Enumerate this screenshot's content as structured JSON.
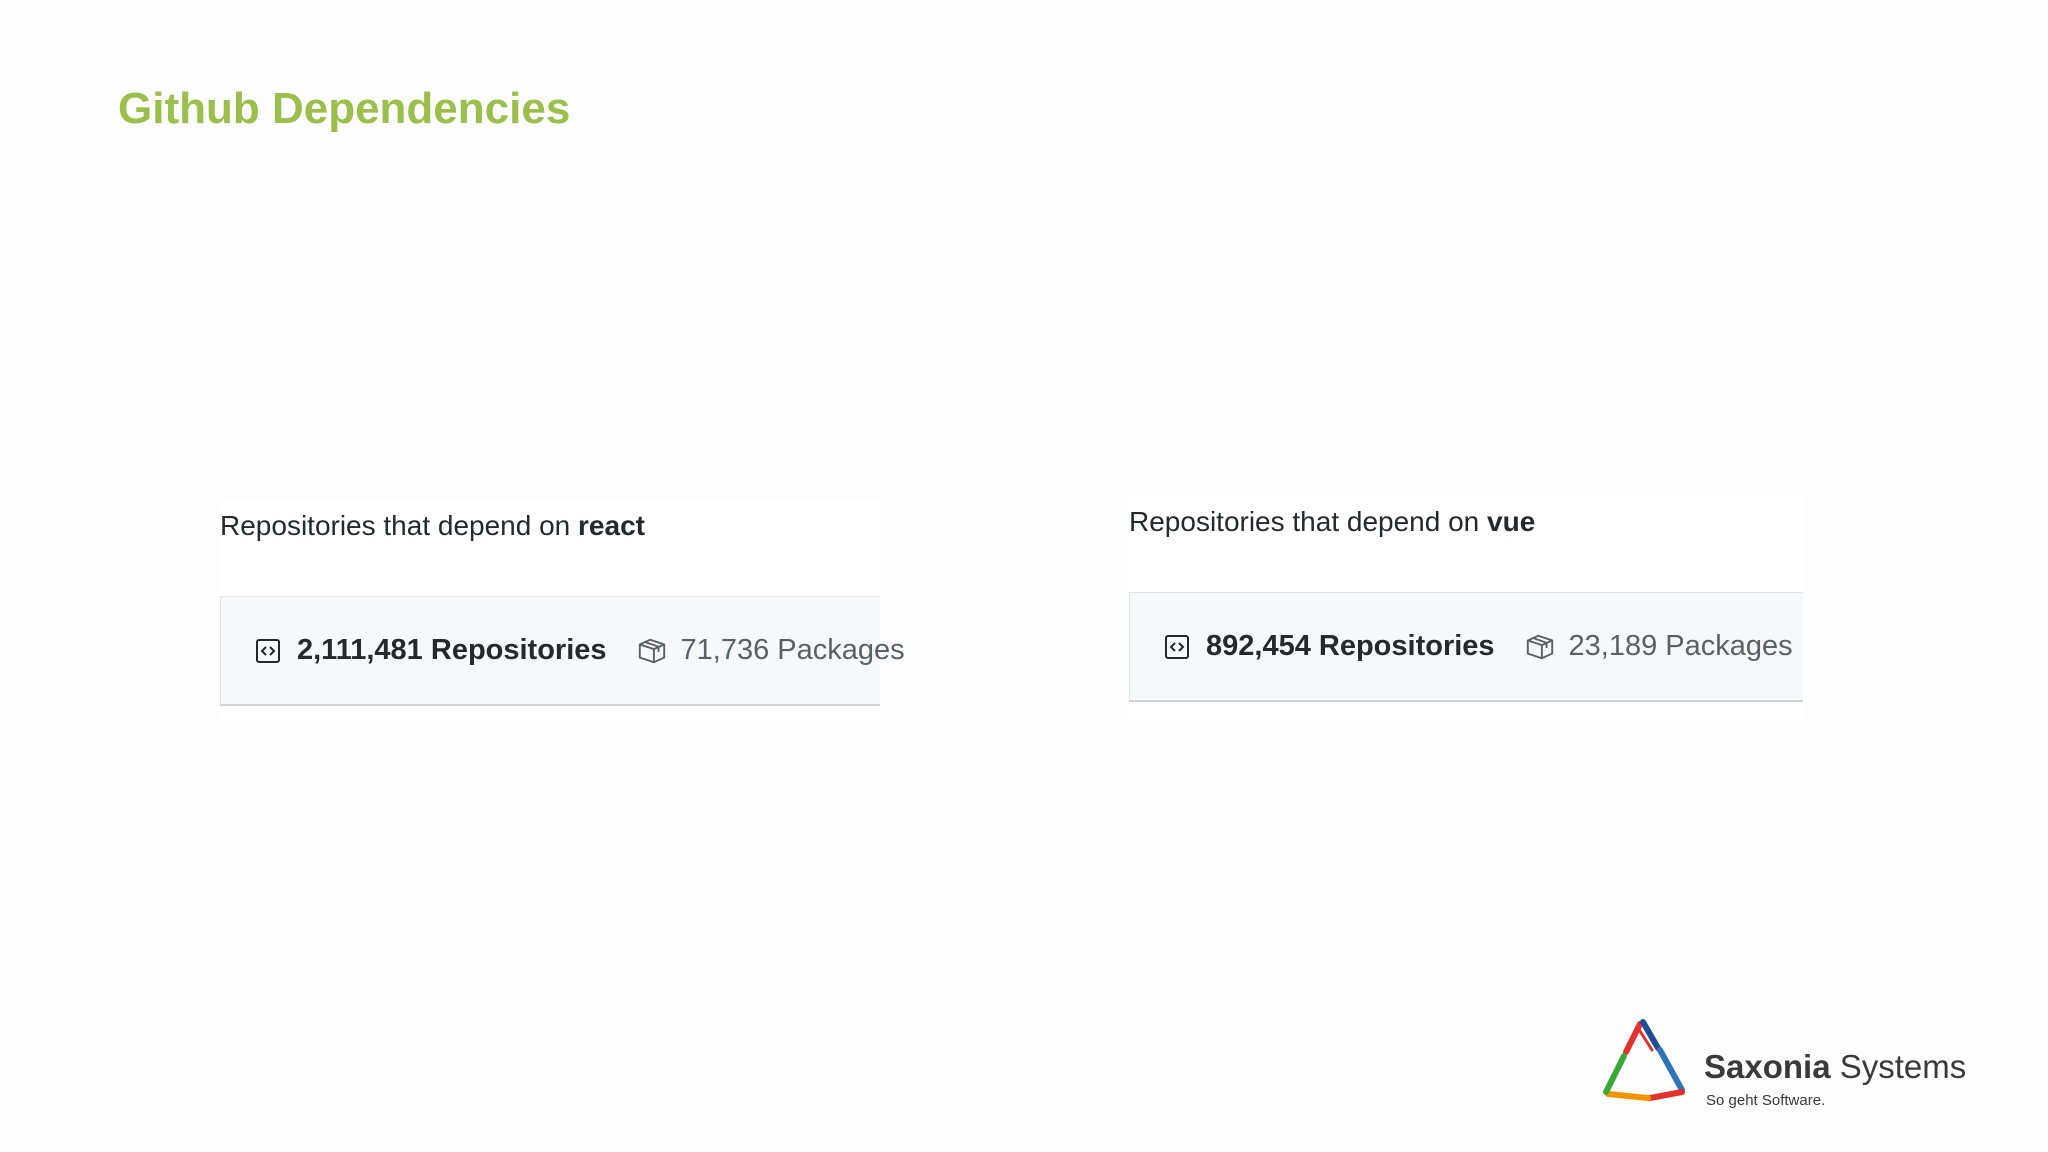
{
  "slide": {
    "title": "Github Dependencies"
  },
  "react": {
    "caption_prefix": "Repositories that depend on ",
    "caption_package": "react",
    "repositories": "2,111,481 Repositories",
    "packages": "71,736 Packages"
  },
  "vue": {
    "caption_prefix": "Repositories that depend on ",
    "caption_package": "vue",
    "repositories": "892,454 Repositories",
    "packages": "23,189 Packages"
  },
  "logo": {
    "name_bold": "Saxonia",
    "name_regular": " Systems",
    "tagline": "So geht Software."
  },
  "colors": {
    "title": "#9bbf4b",
    "text": "#24292e",
    "muted": "#586069",
    "box_background": "#f6f8fa"
  },
  "icons": {
    "repositories": "code-square-icon",
    "packages": "package-box-icon"
  }
}
